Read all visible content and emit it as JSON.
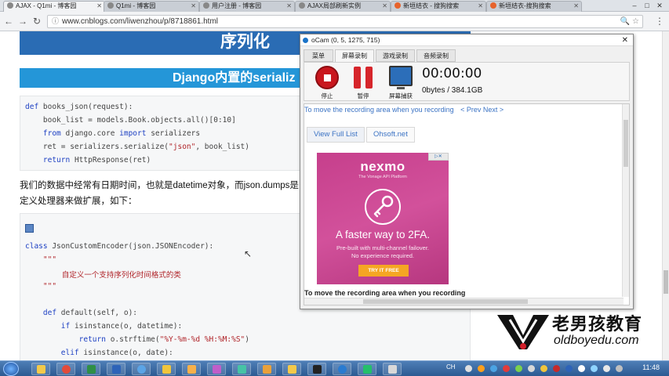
{
  "browser": {
    "tabs": [
      {
        "label": "AJAX - Q1mi - 博客园",
        "active": true
      },
      {
        "label": "Q1mi - 博客园",
        "active": false
      },
      {
        "label": "用户注册 - 博客园",
        "active": false
      },
      {
        "label": "AJAX局部刷新实例",
        "active": false
      },
      {
        "label": "新垣结衣 - 搜狗搜索",
        "active": false
      },
      {
        "label": "新垣结衣-搜狗搜索",
        "active": false
      }
    ],
    "url": "www.cnblogs.com/liwenzhou/p/8718861.html"
  },
  "page": {
    "heading1": "序列化",
    "heading2": "Django内置的serializ",
    "code1": [
      "def books_json(request):",
      "    book_list = models.Book.objects.all()[0:10]",
      "    from django.core import serializers",
      "    ret = serializers.serialize(\"json\", book_list)",
      "    return HttpResponse(ret)"
    ],
    "paragraph_line1": "我们的数据中经常有日期时间，也就是datetime对象，而json.dumps是",
    "paragraph_line2": "定义处理器来做扩展，如下：",
    "code2": [
      "class JsonCustomEncoder(json.JSONEncoder):",
      "    \"\"\"",
      "    自定义一个支持序列化时间格式的类",
      "    \"\"\"",
      "",
      "    def default(self, o):",
      "        if isinstance(o, datetime):",
      "            return o.strftime(\"%Y-%m-%d %H:%M:%S\")",
      "        elif isinstance(o, date):"
    ]
  },
  "ocam": {
    "title": "oCam (0, 5, 1275, 715)",
    "tabs": [
      "菜单",
      "屏幕录制",
      "游戏录制",
      "音频录制"
    ],
    "active_tab": "屏幕录制",
    "buttons": {
      "stop": "停止",
      "pause": "暂停",
      "capture": "屏幕捕获"
    },
    "timer": "00:00:00",
    "size": "0bytes / 384.1GB",
    "hint_top": "To move the recording area when you recording",
    "nav_links": "< Prev Next >",
    "view_tabs": [
      "View Full List",
      "Ohsoft.net"
    ],
    "hint_bottom": "To move the recording area when you recording"
  },
  "ad": {
    "brand": "nexmo",
    "tagline": "The Vonage API Platform",
    "headline": "A faster way to 2FA.",
    "sub_line1": "Pre-built with multi-channel failover.",
    "sub_line2": "No experience required.",
    "cta": "TRY IT FREE",
    "colors": {
      "background": "#c8418f",
      "cta": "#f5a623"
    }
  },
  "watermark": {
    "cn": "老男孩教育",
    "en": "oldboyedu.com"
  },
  "taskbar": {
    "lang": "CH",
    "clock": "11:48"
  }
}
